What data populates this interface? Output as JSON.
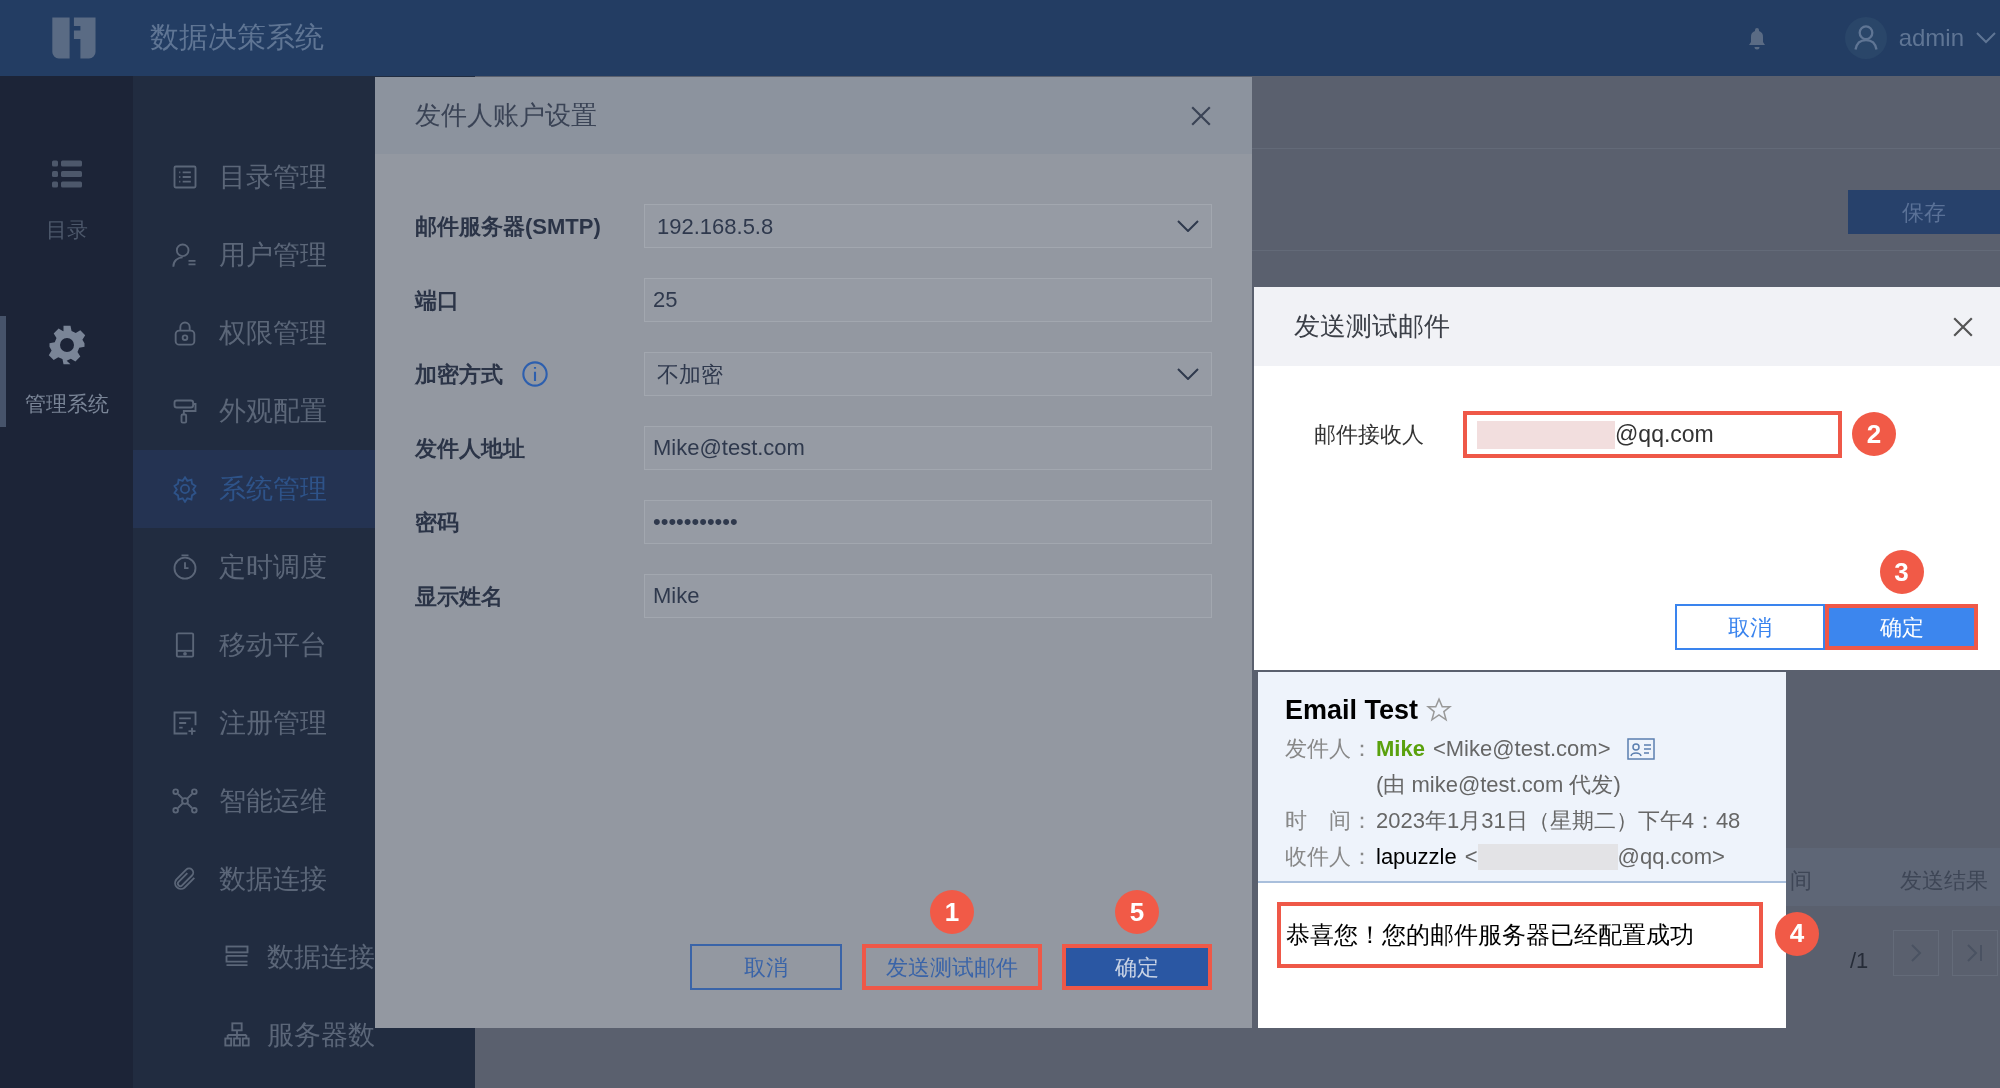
{
  "app": {
    "title": "数据决策系统",
    "user": "admin"
  },
  "rail": [
    {
      "label": "目录",
      "selected": false
    },
    {
      "label": "管理系统",
      "selected": true
    }
  ],
  "menu": [
    {
      "label": "目录管理",
      "selected": false
    },
    {
      "label": "用户管理",
      "selected": false
    },
    {
      "label": "权限管理",
      "selected": false
    },
    {
      "label": "外观配置",
      "selected": false
    },
    {
      "label": "系统管理",
      "selected": true
    },
    {
      "label": "定时调度",
      "selected": false
    },
    {
      "label": "移动平台",
      "selected": false
    },
    {
      "label": "注册管理",
      "selected": false
    },
    {
      "label": "智能运维",
      "selected": false
    },
    {
      "label": "数据连接",
      "selected": false,
      "children": [
        {
          "label": "数据连接",
          "selected": false
        },
        {
          "label": "服务器数",
          "selected": false
        }
      ]
    }
  ],
  "page": {
    "save_button": "保存",
    "columns": [
      "间",
      "发送结果"
    ],
    "page_total": "/1"
  },
  "account_dialog": {
    "title": "发件人账户设置",
    "fields": [
      {
        "label": "邮件服务器(SMTP)",
        "value": "192.168.5.8",
        "kind": "select",
        "info": false
      },
      {
        "label": "端口",
        "value": "25",
        "kind": "text",
        "info": false
      },
      {
        "label": "加密方式",
        "value": "不加密",
        "kind": "select",
        "info": true
      },
      {
        "label": "发件人地址",
        "value": "Mike@test.com",
        "kind": "text",
        "info": false
      },
      {
        "label": "密码",
        "value": "•••••••••••",
        "kind": "text",
        "info": false
      },
      {
        "label": "显示姓名",
        "value": "Mike",
        "kind": "text",
        "info": false
      }
    ],
    "buttons": [
      {
        "label": "取消",
        "kind": "secondary",
        "highlighted": false
      },
      {
        "label": "发送测试邮件",
        "kind": "secondary",
        "highlighted": true,
        "callout": "1"
      },
      {
        "label": "确定",
        "kind": "primary",
        "highlighted": true,
        "callout": "5"
      }
    ]
  },
  "test_dialog": {
    "title": "发送测试邮件",
    "recipient_label": "邮件接收人",
    "recipient_value": "@qq.com",
    "recipient_callout": "2",
    "buttons": [
      {
        "label": "取消",
        "kind": "secondary",
        "highlighted": false
      },
      {
        "label": "确定",
        "kind": "primary",
        "highlighted": true,
        "callout": "3"
      }
    ]
  },
  "email": {
    "subject": "Email Test",
    "rows": [
      {
        "kind": "sender",
        "label": "发件人：",
        "name": "Mike",
        "text": "<Mike@test.com>"
      },
      {
        "kind": "note",
        "text": "(由 mike@test.com 代发)"
      },
      {
        "kind": "plain",
        "label": "时　间：",
        "text": "2023年1月31日（星期二）下午4：48"
      },
      {
        "kind": "recipient",
        "label": "收件人：",
        "name": "lapuzzle",
        "text": "<",
        "text_end": "@qq.com>"
      }
    ],
    "message": "恭喜您！您的邮件服务器已经配置成功",
    "message_callout": "4"
  }
}
